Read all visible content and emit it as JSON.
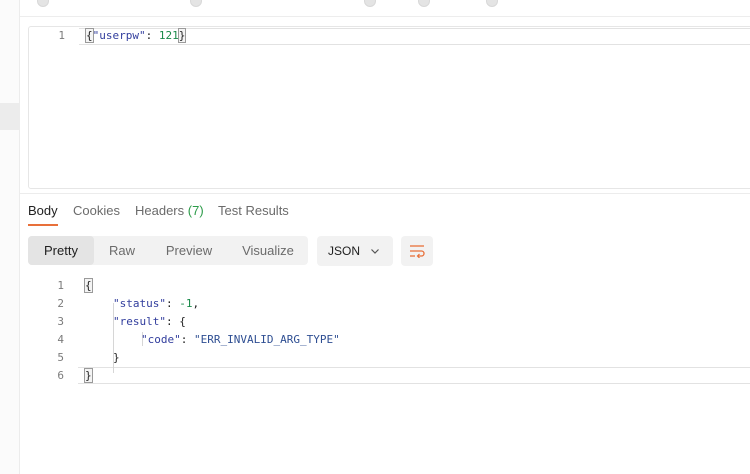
{
  "request": {
    "lines": [
      {
        "num": "1",
        "tokens": [
          {
            "t": "{",
            "c": "punc",
            "hl": true
          },
          {
            "t": "\"userpw\"",
            "c": "key"
          },
          {
            "t": ": ",
            "c": "punc"
          },
          {
            "t": "121",
            "c": "num"
          },
          {
            "t": "}",
            "c": "punc",
            "hl": true
          }
        ]
      }
    ]
  },
  "response_tabs": {
    "body": "Body",
    "cookies": "Cookies",
    "headers": "Headers",
    "headers_count": "(7)",
    "test_results": "Test Results"
  },
  "view_modes": {
    "pretty": "Pretty",
    "raw": "Raw",
    "preview": "Preview",
    "visualize": "Visualize"
  },
  "format": {
    "selected": "JSON"
  },
  "response": {
    "lines": [
      {
        "num": "1",
        "indent": 0,
        "tokens": [
          {
            "t": "{",
            "c": "punc",
            "hl": true
          }
        ]
      },
      {
        "num": "2",
        "indent": 1,
        "tokens": [
          {
            "t": "\"status\"",
            "c": "key"
          },
          {
            "t": ": ",
            "c": "punc"
          },
          {
            "t": "-1",
            "c": "num"
          },
          {
            "t": ",",
            "c": "punc"
          }
        ]
      },
      {
        "num": "3",
        "indent": 1,
        "tokens": [
          {
            "t": "\"result\"",
            "c": "key"
          },
          {
            "t": ": {",
            "c": "punc"
          }
        ]
      },
      {
        "num": "4",
        "indent": 2,
        "tokens": [
          {
            "t": "\"code\"",
            "c": "key"
          },
          {
            "t": ": ",
            "c": "punc"
          },
          {
            "t": "\"ERR_INVALID_ARG_TYPE\"",
            "c": "str"
          }
        ]
      },
      {
        "num": "5",
        "indent": 1,
        "tokens": [
          {
            "t": "}",
            "c": "punc"
          }
        ]
      },
      {
        "num": "6",
        "indent": 0,
        "tokens": [
          {
            "t": "}",
            "c": "punc",
            "hl": true
          }
        ]
      }
    ]
  },
  "colors": {
    "accent_orange": "#e8703a",
    "count_green": "#2c9b49",
    "key_blue": "#313d9d",
    "number_green": "#1a8a4a"
  },
  "icons": {
    "format_dropdown": "chevron-down-icon",
    "wrap": "wrap-lines-icon"
  }
}
